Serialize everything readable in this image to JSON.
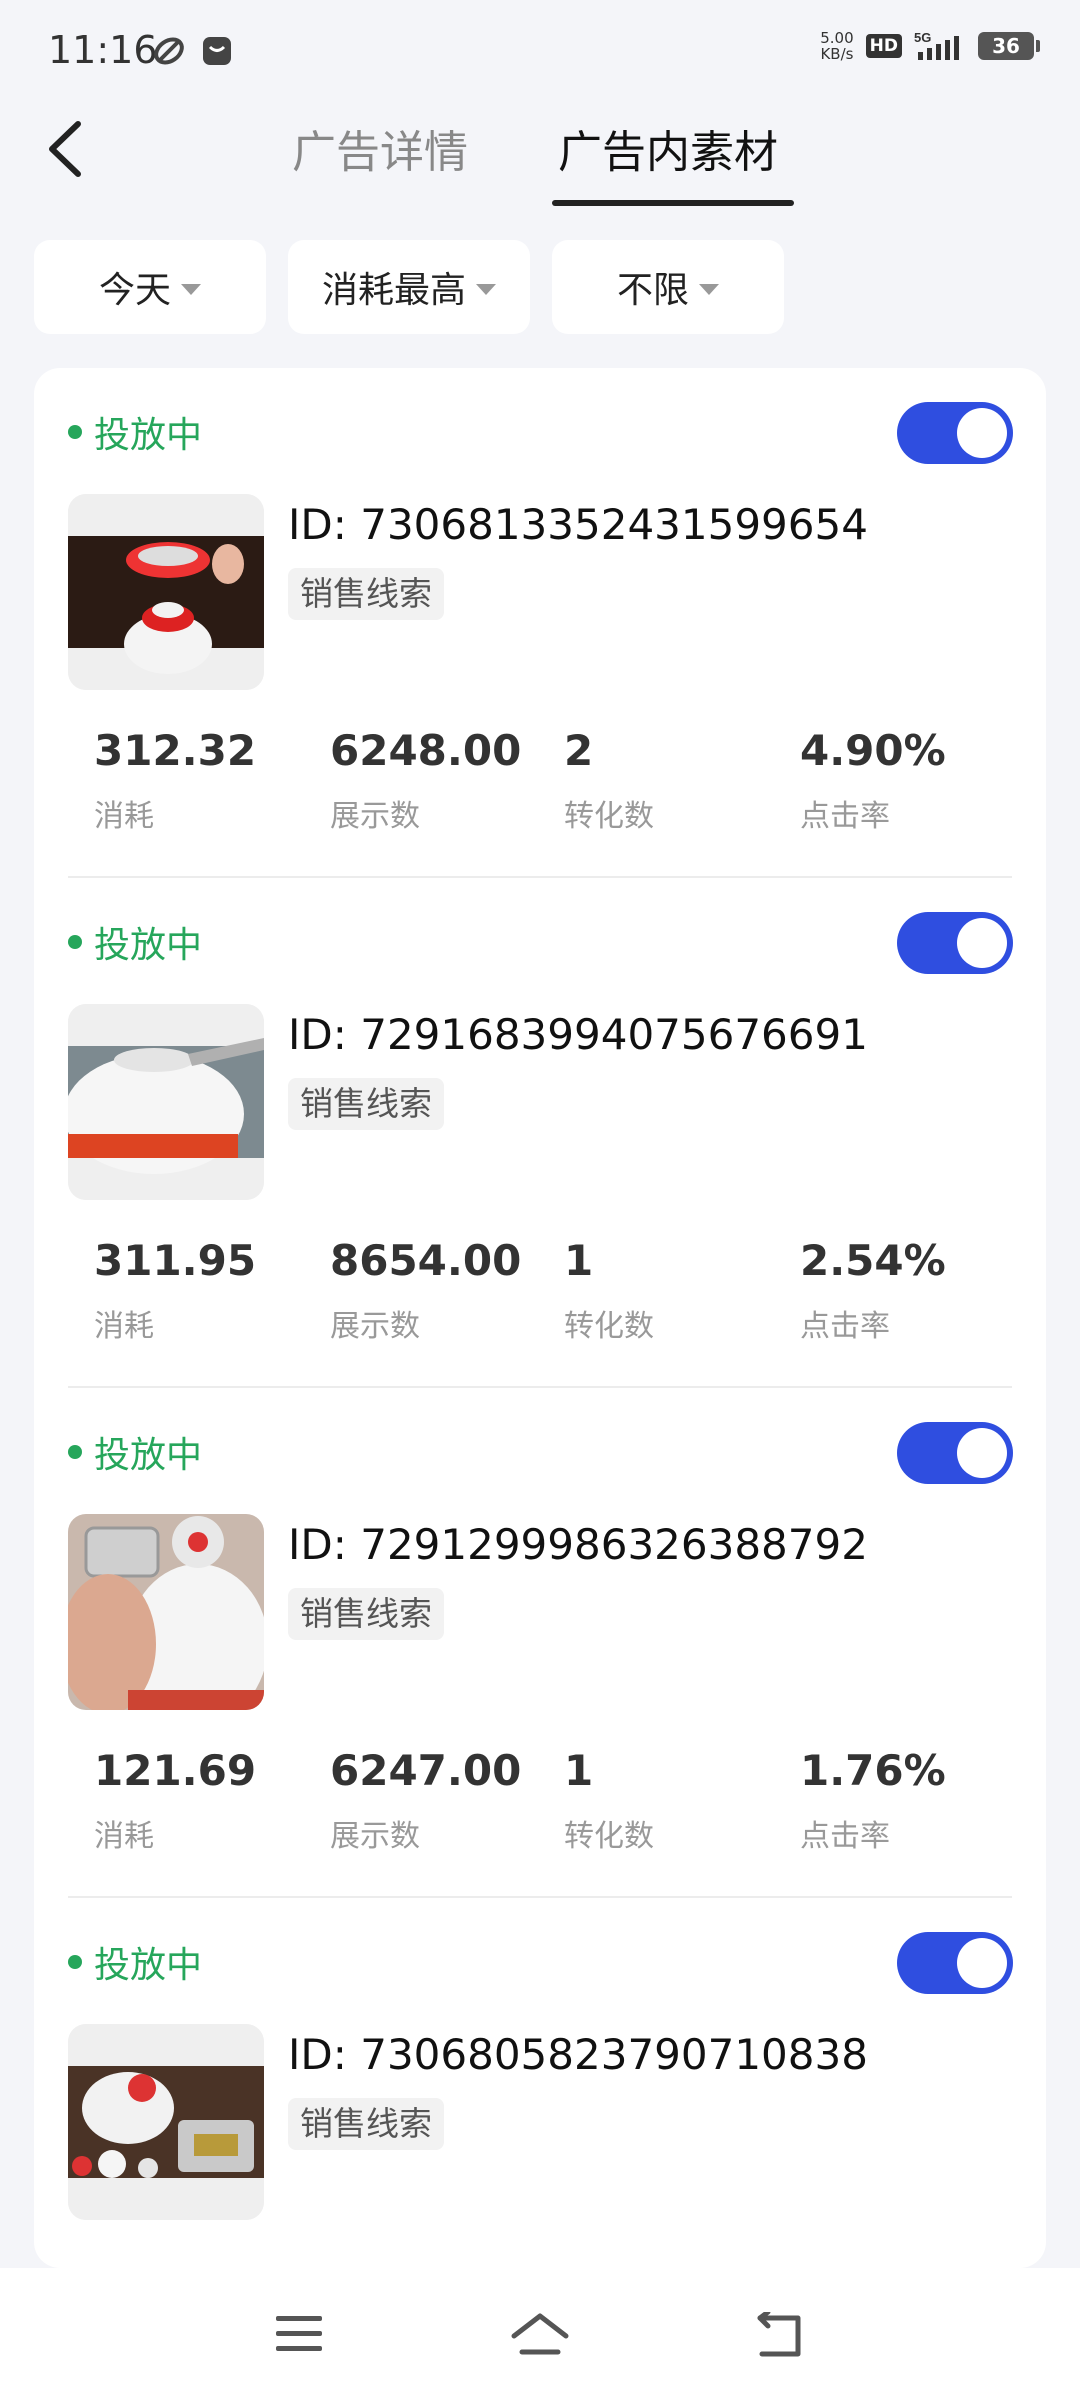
{
  "status_bar": {
    "time": "11:16",
    "net_speed_value": "5.00",
    "net_speed_unit": "KB/s",
    "hd": "HD",
    "network": "5G",
    "battery": "36"
  },
  "header": {
    "tabs": [
      {
        "label": "广告详情",
        "active": false
      },
      {
        "label": "广告内素材",
        "active": true
      }
    ]
  },
  "filters": [
    {
      "label": "今天"
    },
    {
      "label": "消耗最高"
    },
    {
      "label": "不限"
    }
  ],
  "items": [
    {
      "status": "投放中",
      "enabled": true,
      "id_text": "ID: 7306813352431599654",
      "tag": "销售线索",
      "metrics": [
        {
          "value": "312.32",
          "label": "消耗"
        },
        {
          "value": "6248.00",
          "label": "展示数"
        },
        {
          "value": "2",
          "label": "转化数"
        },
        {
          "value": "4.90%",
          "label": "点击率"
        }
      ]
    },
    {
      "status": "投放中",
      "enabled": true,
      "id_text": "ID: 7291683994075676691",
      "tag": "销售线索",
      "metrics": [
        {
          "value": "311.95",
          "label": "消耗"
        },
        {
          "value": "8654.00",
          "label": "展示数"
        },
        {
          "value": "1",
          "label": "转化数"
        },
        {
          "value": "2.54%",
          "label": "点击率"
        }
      ]
    },
    {
      "status": "投放中",
      "enabled": true,
      "id_text": "ID: 7291299986326388792",
      "tag": "销售线索",
      "metrics": [
        {
          "value": "121.69",
          "label": "消耗"
        },
        {
          "value": "6247.00",
          "label": "展示数"
        },
        {
          "value": "1",
          "label": "转化数"
        },
        {
          "value": "1.76%",
          "label": "点击率"
        }
      ]
    },
    {
      "status": "投放中",
      "enabled": true,
      "id_text": "ID: 7306805823790710838",
      "tag": "销售线索",
      "metrics": []
    }
  ],
  "colors": {
    "accent": "#2f4ee0",
    "status_green": "#26a65b",
    "background": "#f4f5f9"
  }
}
